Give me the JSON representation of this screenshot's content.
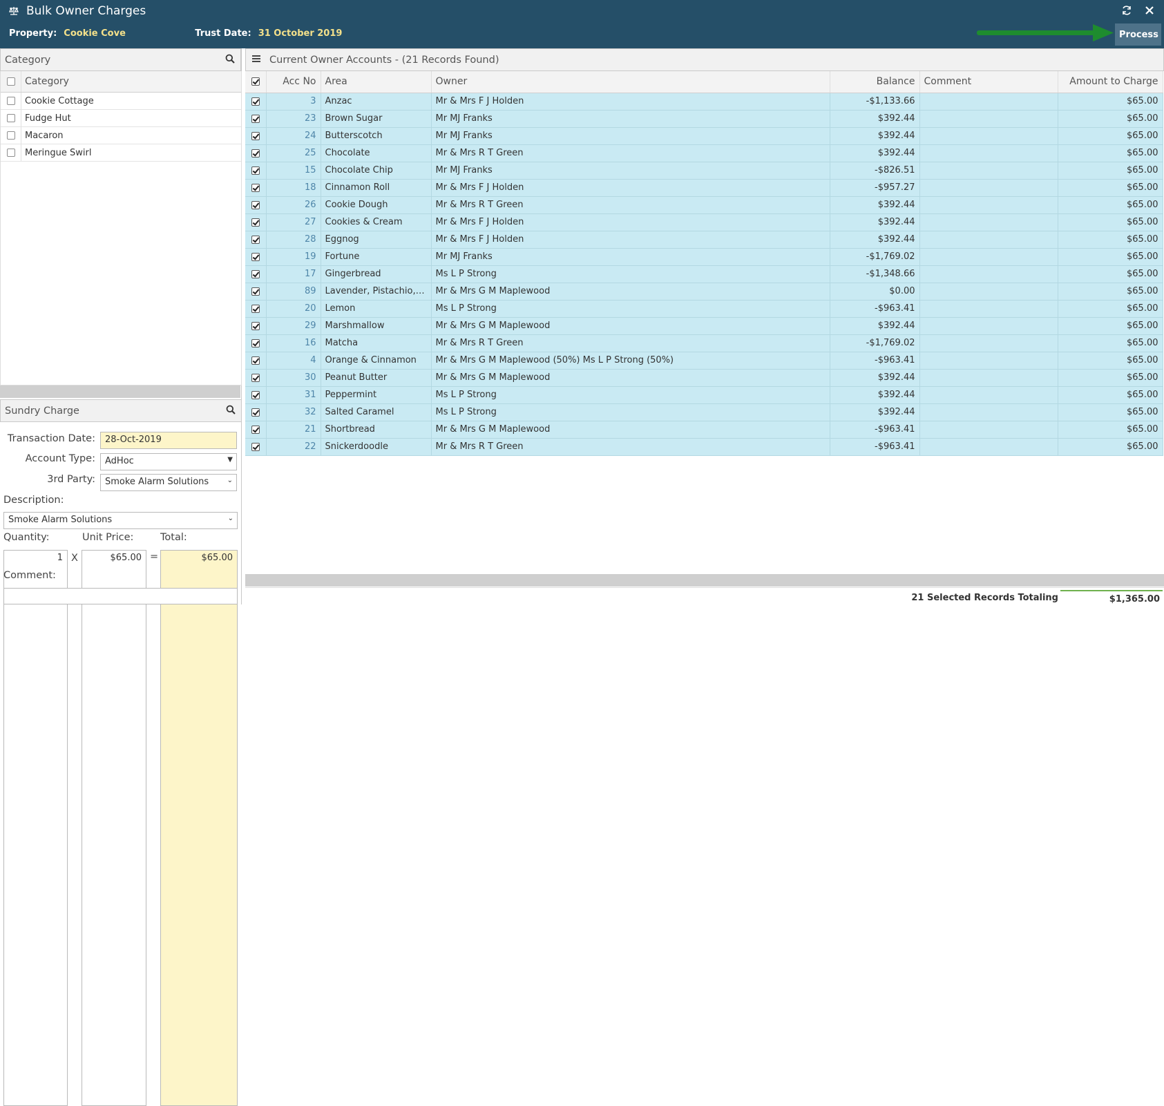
{
  "window": {
    "title": "Bulk Owner Charges",
    "property_label": "Property:",
    "property_value": "Cookie Cove",
    "trust_label": "Trust Date:",
    "trust_value": "31 October 2019",
    "process_label": "Process",
    "colors": {
      "header_bg": "#254f68",
      "accent_text": "#f3e08a",
      "row_bg": "#c9eaf3",
      "arrow": "#1e8c2e"
    }
  },
  "category": {
    "title": "Category",
    "column_header": "Category",
    "items": [
      "Cookie Cottage",
      "Fudge Hut",
      "Macaron",
      "Meringue Swirl"
    ]
  },
  "sundry": {
    "title": "Sundry Charge",
    "transaction_date_label": "Transaction Date:",
    "transaction_date": "28-Oct-2019",
    "account_type_label": "Account Type:",
    "account_type": "AdHoc",
    "third_party_label": "3rd Party:",
    "third_party": "Smoke Alarm Solutions",
    "description_label": "Description:",
    "description": "Smoke Alarm Solutions",
    "quantity_label": "Quantity:",
    "unit_price_label": "Unit Price:",
    "total_label": "Total:",
    "quantity": "1",
    "times": "X",
    "unit_price": "$65.00",
    "equals": "=",
    "total": "$65.00",
    "comment_label": "Comment:",
    "comment": ""
  },
  "grid": {
    "title": "Current Owner Accounts - (21 Records Found)",
    "columns": [
      "Acc No",
      "Area",
      "Owner",
      "Balance",
      "Comment",
      "Amount to Charge"
    ],
    "rows": [
      {
        "acc": "3",
        "area": "Anzac",
        "owner": "Mr & Mrs F J Holden",
        "balance": "-$1,133.66",
        "comment": "",
        "amount": "$65.00"
      },
      {
        "acc": "23",
        "area": "Brown Sugar",
        "owner": "Mr MJ Franks",
        "balance": "$392.44",
        "comment": "",
        "amount": "$65.00"
      },
      {
        "acc": "24",
        "area": "Butterscotch",
        "owner": "Mr MJ Franks",
        "balance": "$392.44",
        "comment": "",
        "amount": "$65.00"
      },
      {
        "acc": "25",
        "area": "Chocolate",
        "owner": "Mr & Mrs R T Green",
        "balance": "$392.44",
        "comment": "",
        "amount": "$65.00"
      },
      {
        "acc": "15",
        "area": "Chocolate Chip",
        "owner": "Mr MJ Franks",
        "balance": "-$826.51",
        "comment": "",
        "amount": "$65.00"
      },
      {
        "acc": "18",
        "area": "Cinnamon Roll",
        "owner": "Mr & Mrs F J Holden",
        "balance": "-$957.27",
        "comment": "",
        "amount": "$65.00"
      },
      {
        "acc": "26",
        "area": "Cookie Dough",
        "owner": "Mr & Mrs R T Green",
        "balance": "$392.44",
        "comment": "",
        "amount": "$65.00"
      },
      {
        "acc": "27",
        "area": "Cookies & Cream",
        "owner": "Mr & Mrs F J Holden",
        "balance": "$392.44",
        "comment": "",
        "amount": "$65.00"
      },
      {
        "acc": "28",
        "area": "Eggnog",
        "owner": "Mr & Mrs F J Holden",
        "balance": "$392.44",
        "comment": "",
        "amount": "$65.00"
      },
      {
        "acc": "19",
        "area": "Fortune",
        "owner": "Mr MJ Franks",
        "balance": "-$1,769.02",
        "comment": "",
        "amount": "$65.00"
      },
      {
        "acc": "17",
        "area": "Gingerbread",
        "owner": "Ms L P Strong",
        "balance": "-$1,348.66",
        "comment": "",
        "amount": "$65.00"
      },
      {
        "acc": "89",
        "area": "Lavender, Pistachio, Pu...",
        "owner": "Mr & Mrs G M Maplewood",
        "balance": "$0.00",
        "comment": "",
        "amount": "$65.00"
      },
      {
        "acc": "20",
        "area": "Lemon",
        "owner": "Ms L P Strong",
        "balance": "-$963.41",
        "comment": "",
        "amount": "$65.00"
      },
      {
        "acc": "29",
        "area": "Marshmallow",
        "owner": "Mr & Mrs G M Maplewood",
        "balance": "$392.44",
        "comment": "",
        "amount": "$65.00"
      },
      {
        "acc": "16",
        "area": "Matcha",
        "owner": "Mr & Mrs R T Green",
        "balance": "-$1,769.02",
        "comment": "",
        "amount": "$65.00"
      },
      {
        "acc": "4",
        "area": "Orange & Cinnamon",
        "owner": "Mr & Mrs G M Maplewood (50%) Ms L P Strong (50%)",
        "balance": "-$963.41",
        "comment": "",
        "amount": "$65.00"
      },
      {
        "acc": "30",
        "area": "Peanut Butter",
        "owner": "Mr & Mrs G M Maplewood",
        "balance": "$392.44",
        "comment": "",
        "amount": "$65.00"
      },
      {
        "acc": "31",
        "area": "Peppermint",
        "owner": "Ms L P Strong",
        "balance": "$392.44",
        "comment": "",
        "amount": "$65.00"
      },
      {
        "acc": "32",
        "area": "Salted Caramel",
        "owner": "Ms L P Strong",
        "balance": "$392.44",
        "comment": "",
        "amount": "$65.00"
      },
      {
        "acc": "21",
        "area": "Shortbread",
        "owner": "Mr & Mrs G M Maplewood",
        "balance": "-$963.41",
        "comment": "",
        "amount": "$65.00"
      },
      {
        "acc": "22",
        "area": "Snickerdoodle",
        "owner": "Mr & Mrs R T Green",
        "balance": "-$963.41",
        "comment": "",
        "amount": "$65.00"
      }
    ],
    "footer_label": "21 Selected Records Totaling",
    "footer_total": "$1,365.00"
  }
}
